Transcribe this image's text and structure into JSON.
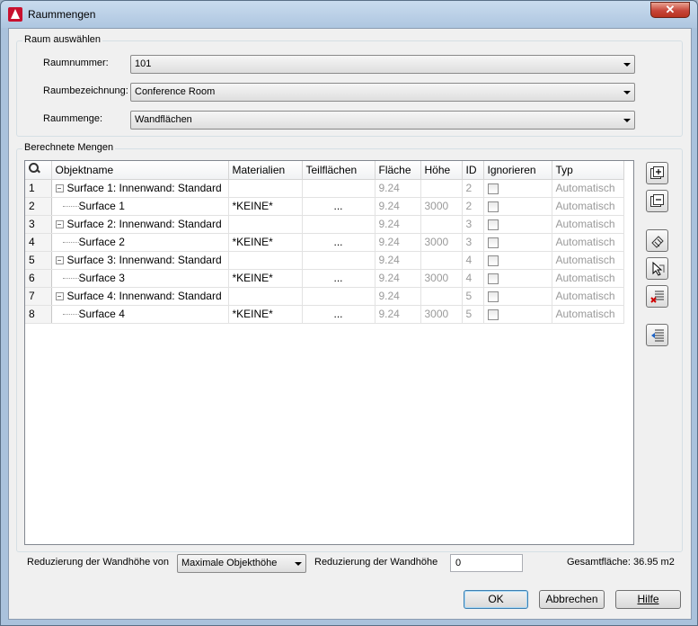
{
  "window": {
    "title": "Raummengen",
    "close_label": "✕"
  },
  "raum_group": {
    "label": "Raum auswählen",
    "raumnummer": {
      "label": "Raumnummer:",
      "value": "101"
    },
    "raumbezeichnung": {
      "label": "Raumbezeichnung:",
      "value": "Conference Room"
    },
    "raummenge": {
      "label": "Raummenge:",
      "value": "Wandflächen"
    }
  },
  "mengen_group": {
    "label": "Berechnete Mengen"
  },
  "grid": {
    "columns": [
      "Objektname",
      "Materialien",
      "Teilflächen",
      "Fläche",
      "Höhe",
      "ID",
      "Ignorieren",
      "Typ"
    ],
    "rows": [
      {
        "num": "1",
        "name": "Surface 1: Innenwand: Standard",
        "parent": true,
        "material": "",
        "teil": "",
        "flaeche": "9.24",
        "hoehe": "",
        "id": "2",
        "typ": "Automatisch"
      },
      {
        "num": "2",
        "name": "Surface 1",
        "parent": false,
        "material": "*KEINE*",
        "teil": "...",
        "flaeche": "9.24",
        "hoehe": "3000",
        "id": "2",
        "typ": "Automatisch"
      },
      {
        "num": "3",
        "name": "Surface 2: Innenwand: Standard",
        "parent": true,
        "material": "",
        "teil": "",
        "flaeche": "9.24",
        "hoehe": "",
        "id": "3",
        "typ": "Automatisch"
      },
      {
        "num": "4",
        "name": "Surface 2",
        "parent": false,
        "material": "*KEINE*",
        "teil": "...",
        "flaeche": "9.24",
        "hoehe": "3000",
        "id": "3",
        "typ": "Automatisch"
      },
      {
        "num": "5",
        "name": "Surface 3: Innenwand: Standard",
        "parent": true,
        "material": "",
        "teil": "",
        "flaeche": "9.24",
        "hoehe": "",
        "id": "4",
        "typ": "Automatisch"
      },
      {
        "num": "6",
        "name": "Surface 3",
        "parent": false,
        "material": "*KEINE*",
        "teil": "...",
        "flaeche": "9.24",
        "hoehe": "3000",
        "id": "4",
        "typ": "Automatisch"
      },
      {
        "num": "7",
        "name": "Surface 4: Innenwand: Standard",
        "parent": true,
        "material": "",
        "teil": "",
        "flaeche": "9.24",
        "hoehe": "",
        "id": "5",
        "typ": "Automatisch"
      },
      {
        "num": "8",
        "name": "Surface 4",
        "parent": false,
        "material": "*KEINE*",
        "teil": "...",
        "flaeche": "9.24",
        "hoehe": "3000",
        "id": "5",
        "typ": "Automatisch"
      }
    ]
  },
  "bottom": {
    "reduz_von_label": "Reduzierung der Wandhöhe von",
    "reduz_von_value": "Maximale Objekthöhe",
    "reduz_label": "Reduzierung der Wandhöhe",
    "reduz_value": "0",
    "gesamt_label": "Gesamtfläche: 36.95 m2"
  },
  "buttons": {
    "ok": "OK",
    "cancel": "Abbrechen",
    "help": "Hilfe"
  },
  "icons": [
    "expand-all-icon",
    "collapse-all-icon",
    "pick-icon",
    "select-objects-icon",
    "remove-icon",
    "export-icon"
  ]
}
